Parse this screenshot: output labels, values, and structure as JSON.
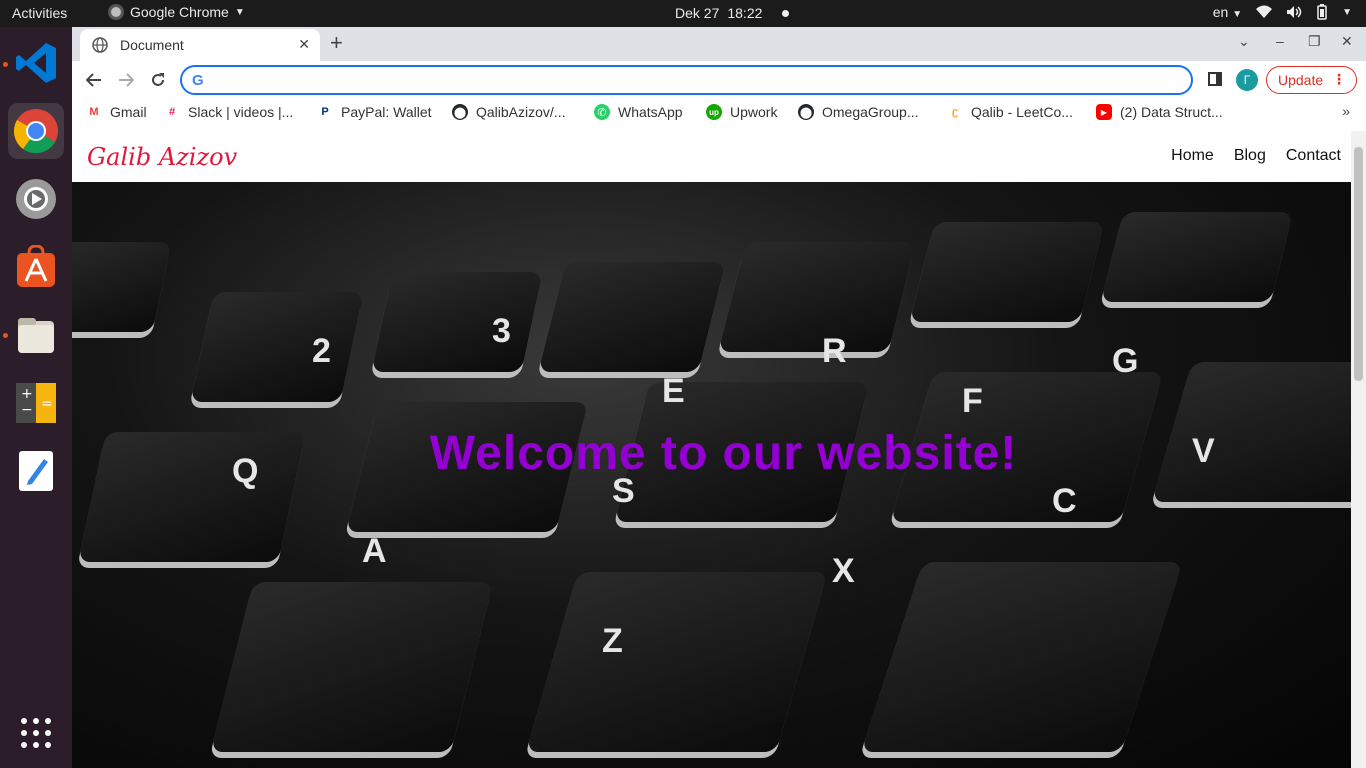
{
  "topbar": {
    "activities": "Activities",
    "app_name": "Google Chrome",
    "date": "Dek 27",
    "time": "18:22",
    "language": "en"
  },
  "dock": {
    "items": [
      "vscode-icon",
      "chrome-icon",
      "settings-icon",
      "software-store-icon",
      "files-icon",
      "calculator-icon",
      "text-editor-icon",
      "app-grid-icon"
    ]
  },
  "browser": {
    "tab_title": "Document",
    "omnibox_value": "",
    "profile_initial": "Γ",
    "update_label": "Update",
    "bookmarks": [
      {
        "label": "Gmail",
        "icon": "gmail-icon",
        "color": "#ea4335"
      },
      {
        "label": "Slack | videos |...",
        "icon": "slack-icon",
        "color": "#4a154b"
      },
      {
        "label": "PayPal: Wallet",
        "icon": "paypal-icon",
        "color": "#003087"
      },
      {
        "label": "QalibAzizov/...",
        "icon": "github-icon",
        "color": "#24292e"
      },
      {
        "label": "WhatsApp",
        "icon": "whatsapp-icon",
        "color": "#25d366"
      },
      {
        "label": "Upwork",
        "icon": "upwork-icon",
        "color": "#14a800"
      },
      {
        "label": "OmegaGroup...",
        "icon": "github-icon",
        "color": "#24292e"
      },
      {
        "label": "Qalib - LeetCo...",
        "icon": "leetcode-icon",
        "color": "#ffa116"
      },
      {
        "label": "(2) Data Struct...",
        "icon": "youtube-icon",
        "color": "#ff0000"
      }
    ]
  },
  "page": {
    "brand": "Galib Azizov",
    "nav": [
      "Home",
      "Blog",
      "Contact"
    ],
    "headline": "Welcome to our website!",
    "headline_color": "#9400d3",
    "brand_color": "#e0193b"
  }
}
